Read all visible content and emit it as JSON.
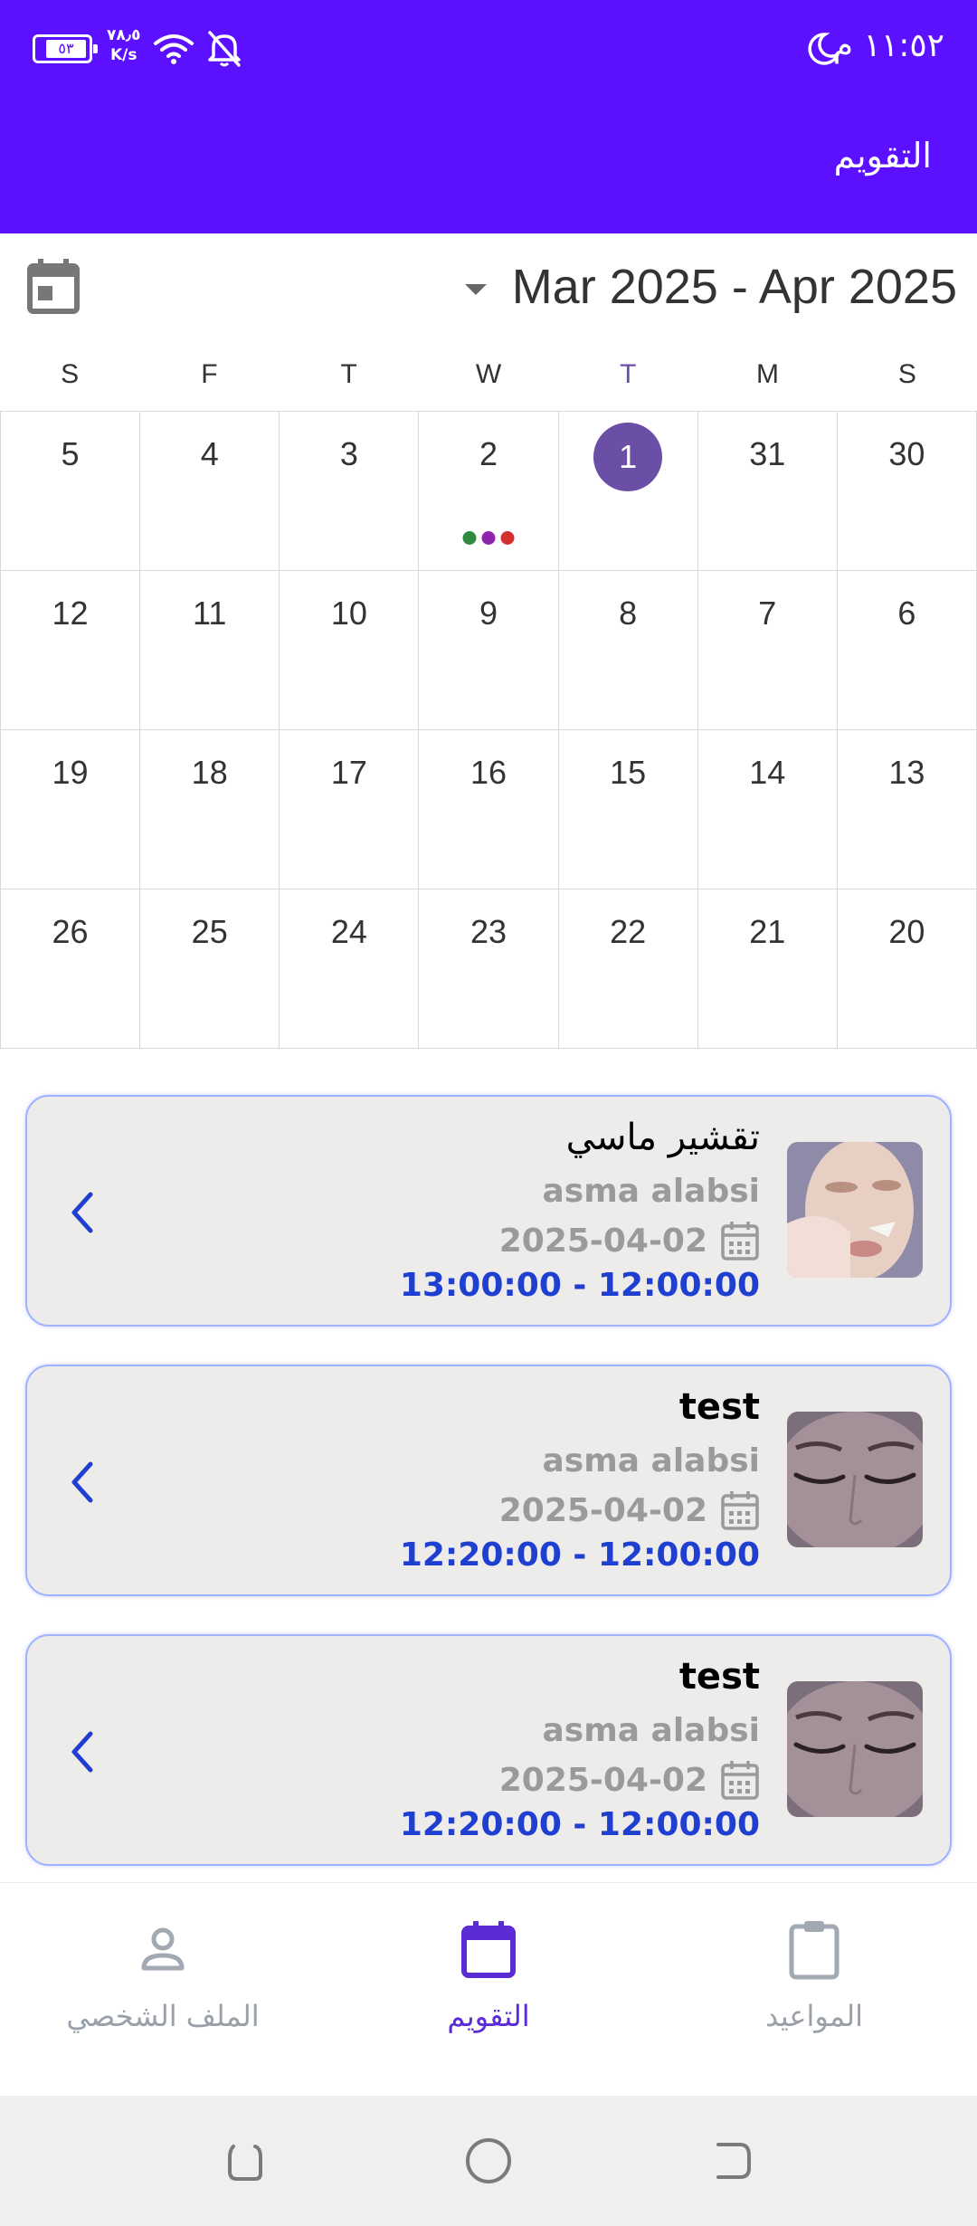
{
  "status_bar": {
    "time": "١١:٥٢ م",
    "battery": "٥٣",
    "net_speed_value": "٧٨٫٥",
    "net_speed_unit": "K/s"
  },
  "header": {
    "title": "التقويم"
  },
  "calendar": {
    "range_title": "Mar 2025 - Apr 2025",
    "weekdays": [
      "S",
      "F",
      "T",
      "W",
      "T",
      "M",
      "S"
    ],
    "weeks": [
      [
        "5",
        "4",
        "3",
        "2",
        "1",
        "31",
        "30"
      ],
      [
        "12",
        "11",
        "10",
        "9",
        "8",
        "7",
        "6"
      ],
      [
        "19",
        "18",
        "17",
        "16",
        "15",
        "14",
        "13"
      ],
      [
        "26",
        "25",
        "24",
        "23",
        "22",
        "21",
        "20"
      ]
    ],
    "today": "1",
    "event_dot_colors": [
      "#2e8b3e",
      "#8e24aa",
      "#d32f2f"
    ]
  },
  "appointments": [
    {
      "title": "تقشير ماسي",
      "client": "asma alabsi",
      "date": "2025-04-02",
      "time_range": "13:00:00  -  12:00:00",
      "thumb_icon": "face-treatment-photo"
    },
    {
      "title": "test",
      "client": "asma alabsi",
      "date": "2025-04-02",
      "time_range": "12:20:00  -  12:00:00",
      "thumb_icon": "eyelash-photo"
    },
    {
      "title": "test",
      "client": "asma alabsi",
      "date": "2025-04-02",
      "time_range": "12:20:00  -  12:00:00",
      "thumb_icon": "eyelash-photo"
    }
  ],
  "bottom_nav": {
    "profile": "الملف الشخصي",
    "calendar": "التقويم",
    "appointments": "المواعيد"
  },
  "colors": {
    "primary": "#5b10ff",
    "today_circle": "#6b4fa6",
    "time_text": "#1f3fd1",
    "nav_active": "#5b2bd6"
  }
}
